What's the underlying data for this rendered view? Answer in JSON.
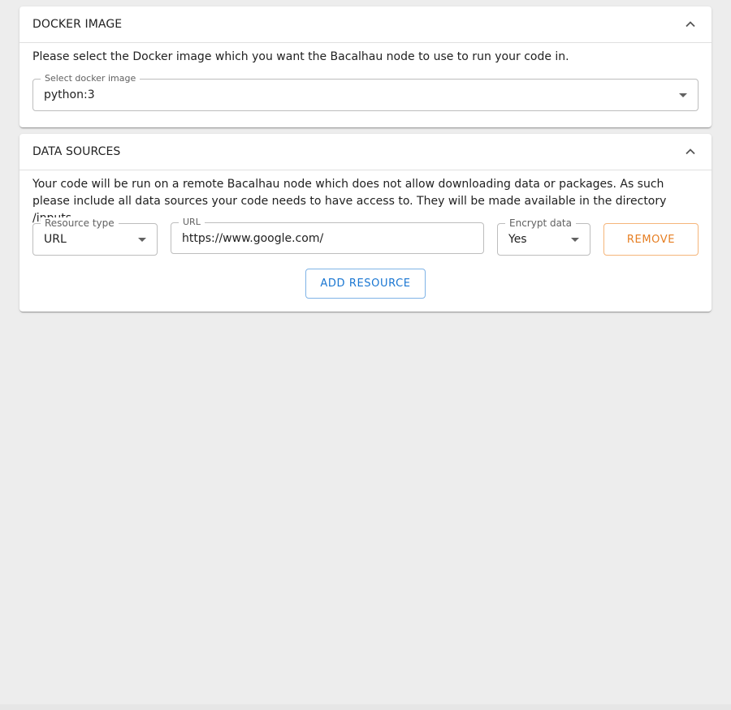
{
  "docker_panel": {
    "title": "DOCKER IMAGE",
    "description": "Please select the Docker image which you want the Bacalhau node to use to run your code in.",
    "select": {
      "label": "Select docker image",
      "value": "python:3"
    }
  },
  "data_sources_panel": {
    "title": "DATA SOURCES",
    "description": "Your code will be run on a remote Bacalhau node which does not allow downloading data or packages. As such please include all data sources your code needs to have access to. They will be made available in the directory /inputs.",
    "resource": {
      "type_label": "Resource type",
      "type_value": "URL",
      "url_label": "URL",
      "url_value": "https://www.google.com/",
      "encrypt_label": "Encrypt data",
      "encrypt_value": "Yes",
      "remove_label": "REMOVE"
    },
    "add_label": "ADD RESOURCE"
  },
  "icons": {
    "collapse": "chevron-up-icon",
    "dropdown": "caret-down-icon"
  },
  "colors": {
    "remove_accent": "#e67e22",
    "add_accent": "#1976d2",
    "background": "#ededed"
  }
}
